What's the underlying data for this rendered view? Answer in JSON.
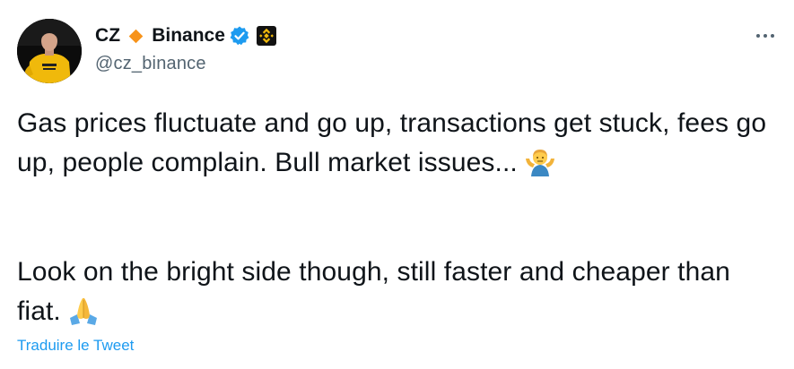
{
  "author": {
    "name_part1": "CZ",
    "name_part2": "Binance",
    "handle": "@cz_binance",
    "avatar_icon": "avatar-photo",
    "diamond_color": "#f7931a",
    "verified_color": "#1d9bf0",
    "affiliate_badge_color": "#f0b90b"
  },
  "tweet": {
    "paragraph1": "Gas prices fluctuate and go up, transactions get stuck, fees go up, people complain. Bull market issues...",
    "paragraph2": "Look on the bright side though, still faster and cheaper than fiat.",
    "emoji1": "person-shrugging-emoji",
    "emoji2": "folded-hands-emoji"
  },
  "actions": {
    "translate_label": "Traduire le Tweet",
    "more_icon": "more-horizontal-icon"
  }
}
